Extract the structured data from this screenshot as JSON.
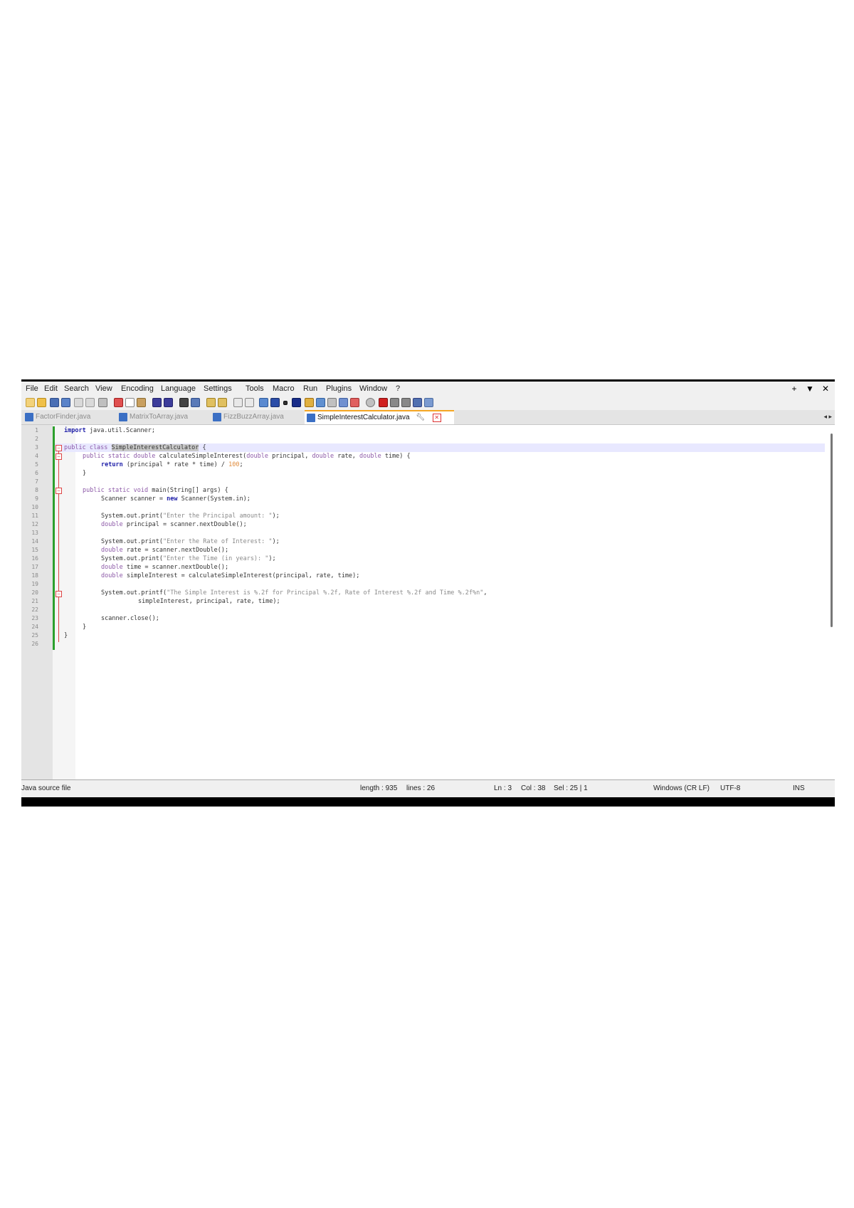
{
  "menu": [
    "File",
    "Edit",
    "Search",
    "View",
    "Encoding",
    "Language",
    "Settings",
    "Tools",
    "Macro",
    "Run",
    "Plugins",
    "Window",
    "?"
  ],
  "window_controls": [
    "+",
    "▼",
    "✕"
  ],
  "tabs": [
    {
      "label": "FactorFinder.java",
      "active": false
    },
    {
      "label": "MatrixToArray.java",
      "active": false
    },
    {
      "label": "FizzBuzzArray.java",
      "active": false
    },
    {
      "label": "SimpleInterestCalculator.java",
      "active": true
    }
  ],
  "tab_arrows": "◂ ▸",
  "code": {
    "line_numbers": [
      "1",
      "2",
      "3",
      "4",
      "5",
      "6",
      "7",
      "8",
      "9",
      "10",
      "11",
      "12",
      "13",
      "14",
      "15",
      "16",
      "17",
      "18",
      "19",
      "20",
      "21",
      "22",
      "23",
      "24",
      "25",
      "26"
    ],
    "l1_kw": "import",
    "l1_rest": " java.util.Scanner;",
    "l3_kw": "public class",
    "l3_space": " ",
    "l3_name": "SimpleInterestCalculator",
    "l3_brace": " {",
    "l4_kw": "public static double",
    "l4_a": " calculateSimpleInterest(",
    "l4_t1": "double",
    "l4_b": " principal, ",
    "l4_t2": "double",
    "l4_c": " rate, ",
    "l4_t3": "double",
    "l4_d": " time) {",
    "l5_kw": "return",
    "l5_a": " (principal * rate * time) / ",
    "l5_num": "100",
    "l5_b": ";",
    "l6": "}",
    "l8_kw": "public static void",
    "l8_a": " main(String[] args) {",
    "l9_a": "Scanner scanner = ",
    "l9_kw": "new",
    "l9_b": " Scanner(System.in);",
    "l11_a": "System.out.print(",
    "l11_str": "\"Enter the Principal amount: \"",
    "l11_b": ");",
    "l12_t": "double",
    "l12_a": " principal = scanner.nextDouble();",
    "l14_a": "System.out.print(",
    "l14_str": "\"Enter the Rate of Interest: \"",
    "l14_b": ");",
    "l15_t": "double",
    "l15_a": " rate = scanner.nextDouble();",
    "l16_a": "System.out.print(",
    "l16_str": "\"Enter the Time (in years): \"",
    "l16_b": ");",
    "l17_t": "double",
    "l17_a": " time = scanner.nextDouble();",
    "l18_t": "double",
    "l18_a": " simpleInterest = calculateSimpleInterest(principal, rate, time);",
    "l20_a": "System.out.printf(",
    "l20_str": "\"The Simple Interest is %.2f for Principal %.2f, Rate of Interest %.2f and Time %.2f%n\"",
    "l20_b": ",",
    "l21": "simpleInterest, principal, rate, time);",
    "l23": "scanner.close();",
    "l24": "}",
    "l25": "}"
  },
  "status": {
    "file_type": "Java source file",
    "length": "length : 935",
    "lines": "lines : 26",
    "ln": "Ln : 3",
    "col": "Col : 38",
    "sel": "Sel : 25 | 1",
    "eol": "Windows (CR LF)",
    "encoding": "UTF-8",
    "mode": "INS"
  },
  "colors": {
    "keyword": "#1e1ea8",
    "type": "#8d5aa8",
    "string": "#8a8a8a",
    "number": "#e08a3a",
    "change_bar": "#2ca02c",
    "active_tab_accent": "#f5a623"
  }
}
